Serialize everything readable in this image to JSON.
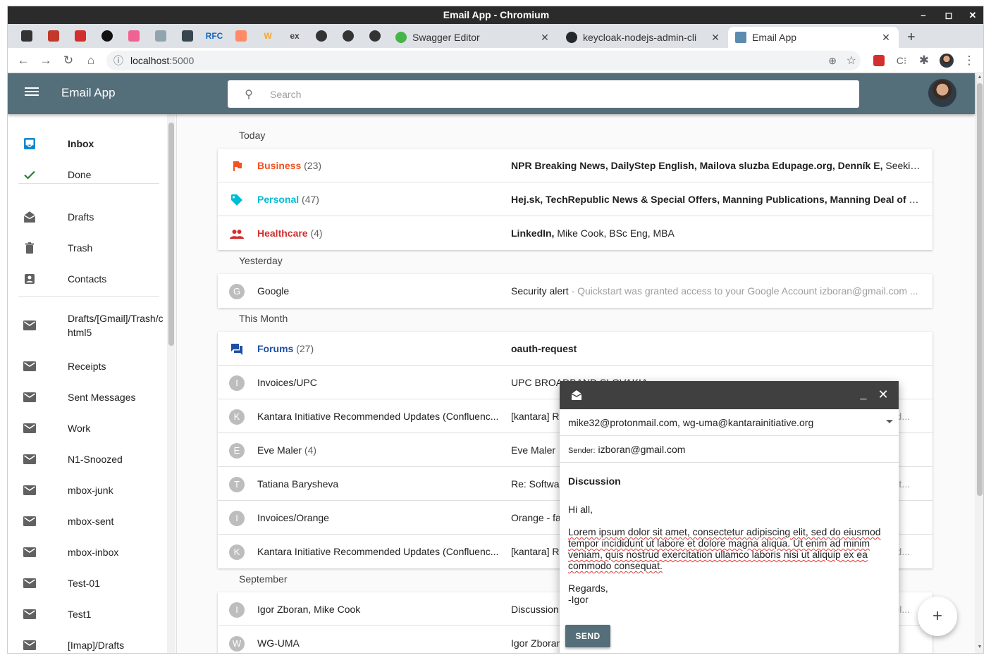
{
  "window": {
    "title": "Email App - Chromium"
  },
  "tabs": {
    "pinned_colors": [
      "#333333",
      "#c0392b",
      "#d32f2f",
      "#111111",
      "#f06292",
      "#90a4ae",
      "#37474f",
      "#1565c0",
      "#ff8a65",
      "#f9a825",
      "#424242",
      "#333333",
      "#333333",
      "#333333"
    ],
    "pinned_text": {
      "rfc": "RFC",
      "ex": "ex",
      "w": "W"
    },
    "items": [
      {
        "label": "Swagger Editor",
        "close": "✕"
      },
      {
        "label": "keycloak-nodejs-admin-cli",
        "close": "✕"
      },
      {
        "label": "Email App",
        "close": "✕"
      }
    ],
    "new_tab": "+"
  },
  "address_bar": {
    "host": "localhost",
    "port": ":5000"
  },
  "app": {
    "title": "Email App",
    "search_placeholder": "Search"
  },
  "sidebar": {
    "items": [
      {
        "label": "Inbox",
        "icon": "inbox-icon",
        "active": true
      },
      {
        "label": "Done",
        "icon": "check-icon"
      },
      {
        "label": "Drafts",
        "icon": "drafts-icon"
      },
      {
        "label": "Trash",
        "icon": "trash-icon"
      },
      {
        "label": "Contacts",
        "icon": "contacts-icon"
      },
      {
        "label": "Drafts/[Gmail]/Trash/c html5",
        "icon": "mail-icon"
      },
      {
        "label": "Receipts",
        "icon": "mail-icon"
      },
      {
        "label": "Sent Messages",
        "icon": "mail-icon"
      },
      {
        "label": "Work",
        "icon": "mail-icon"
      },
      {
        "label": "N1-Snoozed",
        "icon": "mail-icon"
      },
      {
        "label": "mbox-junk",
        "icon": "mail-icon"
      },
      {
        "label": "mbox-sent",
        "icon": "mail-icon"
      },
      {
        "label": "mbox-inbox",
        "icon": "mail-icon"
      },
      {
        "label": "Test-01",
        "icon": "mail-icon"
      },
      {
        "label": "Test1",
        "icon": "mail-icon"
      },
      {
        "label": "[Imap]/Drafts",
        "icon": "mail-icon"
      }
    ]
  },
  "groups": [
    {
      "label": "Today",
      "rows": [
        {
          "name": "Business",
          "count": "(23)",
          "color": "#f4511e",
          "icon": "flag-icon",
          "subject": "NPR Breaking News, DailyStep English, Mailova sluzba Edupage.org, Denník E,",
          "rest": " Seeking Al..."
        },
        {
          "name": "Personal",
          "count": "(47)",
          "color": "#00bcd4",
          "icon": "tag-icon",
          "subject": "Hej.sk, TechRepublic News & Special Offers, Manning Publications, Manning Deal of the D...",
          "rest": ""
        },
        {
          "name": "Healthcare",
          "count": "(4)",
          "color": "#d32f2f",
          "icon": "people-icon",
          "subject": "LinkedIn,",
          "rest": " Mike Cook, BSc Eng, MBA"
        }
      ]
    },
    {
      "label": "Yesterday",
      "rows": [
        {
          "name": "Google",
          "avatar": "G",
          "subject": "Security alert",
          "preview": " - Quickstart was granted access to your Google Account izboran@gmail.com ..."
        }
      ]
    },
    {
      "label": "This Month",
      "rows": [
        {
          "name": "Forums",
          "count": "(27)",
          "color": "#1e4fa3",
          "icon": "forum-icon",
          "subject": "oauth-request",
          "bold": true
        },
        {
          "name": "Invoices/UPC",
          "avatar": "I",
          "subject": "UPC BROADBAND SLOVAKIA"
        },
        {
          "name": "Kantara Initiative Recommended Updates (Confluenc...",
          "avatar": "K",
          "subject": "[kantara] R",
          "preview": "ded..."
        },
        {
          "name": "Eve Maler",
          "count": "(4)",
          "avatar": "E",
          "subject": "Eve Maler"
        },
        {
          "name": "Tatiana Barysheva",
          "avatar": "T",
          "subject": "Re: Softwa",
          "preview": "just..."
        },
        {
          "name": "Invoices/Orange",
          "avatar": "I",
          "subject": "Orange - fa"
        },
        {
          "name": "Kantara Initiative Recommended Updates (Confluenc...",
          "avatar": "K",
          "subject": "[kantara] R",
          "preview": "ded..."
        }
      ]
    },
    {
      "label": "September",
      "rows": [
        {
          "name": "Igor Zboran, Mike Cook",
          "avatar": "I",
          "subject": "Discussion",
          "preview": "sibl..."
        },
        {
          "name": "WG-UMA",
          "avatar": "W",
          "subject": "Igor Zboran"
        }
      ]
    }
  ],
  "compose": {
    "to": "mike32@protonmail.com, wg-uma@kantarainitiative.org",
    "sender_label": "Sender:",
    "sender": "izboran@gmail.com",
    "subject": "Discussion",
    "greeting": "Hi all,",
    "lorem": "Lorem ipsum dolor sit amet, consectetur adipiscing elit, sed do eiusmod tempor incididunt ut labore et dolore magna aliqua. Ut enim ad minim veniam, quis nostrud exercitation ullamco laboris nisi ut aliquip ex ea commodo consequat.",
    "regards": "Regards,",
    "signature": "-Igor",
    "send_label": "SEND",
    "minimize": "_",
    "close": "✕"
  },
  "fab": {
    "label": "+"
  },
  "colors": {
    "appbar": "#546e7a",
    "accent_inbox": "#0288d1",
    "done_check": "#2e7d32"
  }
}
